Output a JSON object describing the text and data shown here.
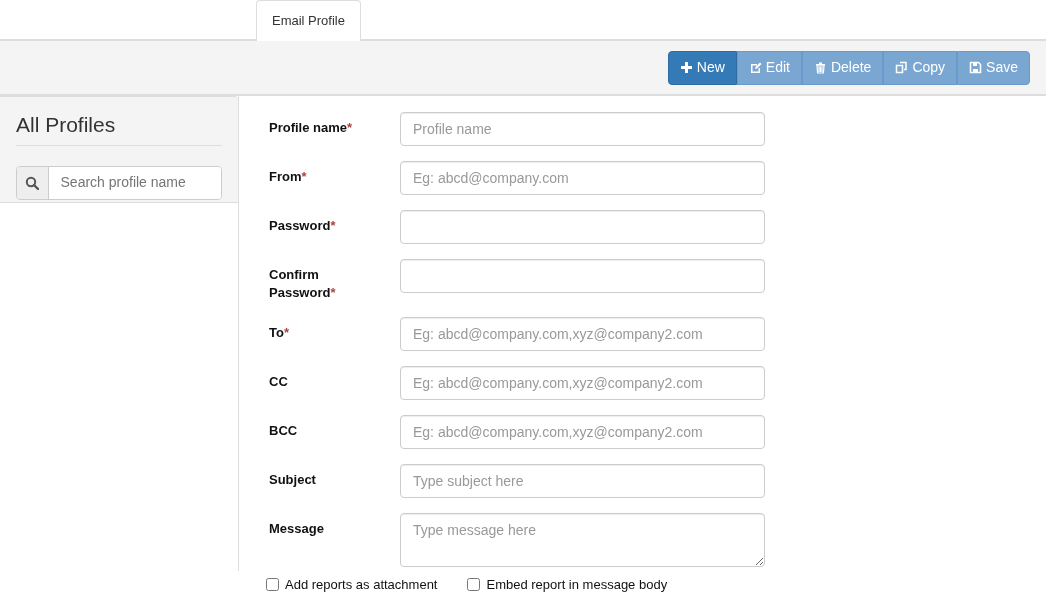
{
  "tabs": [
    {
      "label": "Email Profile",
      "selected": true
    }
  ],
  "toolbar": {
    "buttons": [
      {
        "label": "New",
        "disabled": false
      },
      {
        "label": "Edit",
        "disabled": true
      },
      {
        "label": "Delete",
        "disabled": true
      },
      {
        "label": "Copy",
        "disabled": true
      },
      {
        "label": "Save",
        "disabled": true
      }
    ]
  },
  "sidebar": {
    "title": "All Profiles",
    "search": {
      "placeholder": "Search profile name"
    }
  },
  "form": {
    "fields": [
      {
        "label": "Profile name",
        "required": true,
        "kind": "text",
        "placeholder": "Profile name"
      },
      {
        "label": "From",
        "required": true,
        "kind": "text",
        "placeholder": "Eg: abcd@company.com"
      },
      {
        "label": "Password",
        "required": true,
        "kind": "password"
      },
      {
        "label": "Confirm Password",
        "required": true,
        "kind": "password"
      },
      {
        "label": "To",
        "required": true,
        "kind": "text",
        "placeholder": "Eg: abcd@company.com,xyz@company2.com"
      },
      {
        "label": "CC",
        "required": false,
        "kind": "text",
        "placeholder": "Eg: abcd@company.com,xyz@company2.com"
      },
      {
        "label": "BCC",
        "required": false,
        "kind": "text",
        "placeholder": "Eg: abcd@company.com,xyz@company2.com"
      },
      {
        "label": "Subject",
        "required": false,
        "kind": "text",
        "placeholder": "Type subject here"
      },
      {
        "label": "Message",
        "required": false,
        "kind": "textarea",
        "placeholder": "Type message here"
      }
    ],
    "required_mark": "*",
    "options": [
      {
        "label": "Add reports as attachment",
        "checked": false
      },
      {
        "label": "Embed report in message body",
        "checked": false
      }
    ]
  }
}
